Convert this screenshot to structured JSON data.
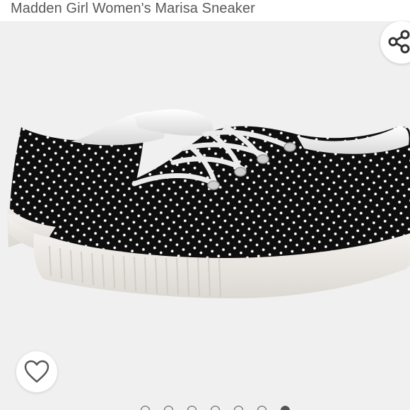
{
  "product": {
    "title": "Madden Girl Women's Marisa Sneaker"
  },
  "actions": {
    "share_icon": "share-icon",
    "wishlist_icon": "heart-outline-icon"
  },
  "image": {
    "subject": "black polka dot canvas sneaker with white laces and white rubber sole",
    "background_color": "#f0f0f0",
    "upper_color": "#0e0e0e",
    "dot_color": "#ffffff",
    "sole_color": "#eae7e2"
  },
  "carousel": {
    "total": 7,
    "active_index": 6
  }
}
